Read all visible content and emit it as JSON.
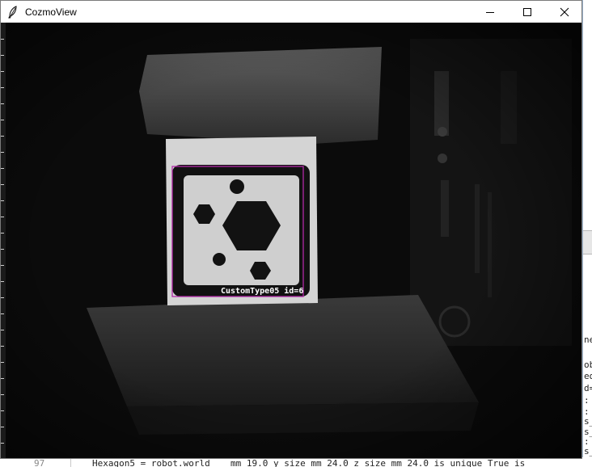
{
  "window": {
    "title": "CozmoView",
    "icon": "feather-icon",
    "controls": {
      "minimize": "minimize-icon",
      "maximize": "maximize-icon",
      "close": "close-icon"
    }
  },
  "camera_view": {
    "detection": {
      "label": "CustomType05 id=6",
      "box_color": "#b22aa8",
      "marker_symbol": "hexagon-pattern"
    }
  },
  "background_editor": {
    "right_fragments": [
      "ne",
      "ob",
      "ed",
      "d=",
      ":",
      ":",
      "s_",
      "s_",
      ":",
      "s_"
    ],
    "bottom_line": {
      "line_number": "97",
      "code_left": "Hexagon5 = robot.world",
      "code_right": "mm 19.0 y_size_mm 24.0 z_size_mm 24.0 is_unique True is"
    }
  },
  "colors": {
    "titlebar_bg": "#ffffff",
    "camera_bg": "#050505",
    "detection_box": "#b22aa8"
  }
}
